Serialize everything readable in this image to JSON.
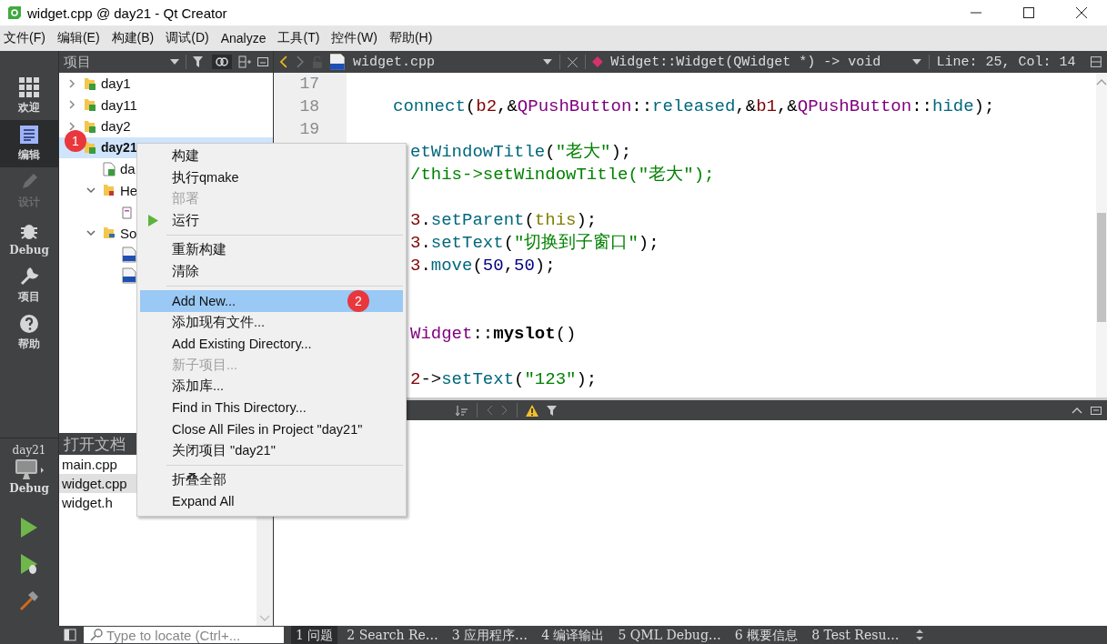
{
  "window": {
    "title": "widget.cpp @ day21 - Qt Creator"
  },
  "menu_bar": [
    "文件(F)",
    "编辑(E)",
    "构建(B)",
    "调试(D)",
    "Analyze",
    "工具(T)",
    "控件(W)",
    "帮助(H)"
  ],
  "mode_bar": {
    "modes": [
      {
        "label": "欢迎",
        "kind": "welcome",
        "selected": false,
        "disabled": false
      },
      {
        "label": "编辑",
        "kind": "edit",
        "selected": true,
        "disabled": false
      },
      {
        "label": "设计",
        "kind": "design",
        "selected": false,
        "disabled": true
      },
      {
        "label": "Debug",
        "kind": "debug",
        "selected": false,
        "disabled": false
      },
      {
        "label": "项目",
        "kind": "projects",
        "selected": false,
        "disabled": false
      },
      {
        "label": "帮助",
        "kind": "help",
        "selected": false,
        "disabled": false
      }
    ],
    "kit": {
      "project": "day21",
      "config": "Debug"
    }
  },
  "project_panel": {
    "title": "项目",
    "tree": [
      {
        "label": "day1",
        "kind": "project",
        "expanded": false,
        "selected": false
      },
      {
        "label": "day11",
        "kind": "project",
        "expanded": false,
        "selected": false
      },
      {
        "label": "day2",
        "kind": "project",
        "expanded": false,
        "selected": false
      },
      {
        "label": "day21",
        "kind": "project",
        "expanded": true,
        "selected": true,
        "badge": "1",
        "children": [
          {
            "label": "da",
            "kind": "pro-file",
            "selected": false
          },
          {
            "label": "He",
            "kind": "header-folder",
            "expanded": true,
            "selected": false,
            "children": [
              {
                "kind": "header-file",
                "selected": false
              }
            ]
          },
          {
            "label": "So",
            "kind": "source-folder",
            "expanded": true,
            "selected": false,
            "children": [
              {
                "kind": "cpp-file",
                "selected": false
              },
              {
                "kind": "cpp-file",
                "selected": false
              }
            ]
          }
        ]
      }
    ]
  },
  "open_documents": {
    "title": "打开文档",
    "items": [
      {
        "label": "main.cpp",
        "selected": false
      },
      {
        "label": "widget.cpp",
        "selected": true
      },
      {
        "label": "widget.h",
        "selected": false
      }
    ]
  },
  "editor": {
    "file": "widget.cpp",
    "symbol": "Widget::Widget(QWidget *) -> void",
    "position": "Line: 25, Col: 14",
    "line_numbers": [
      "17",
      "18",
      "19"
    ],
    "lines": [
      {
        "kind": "full"
      },
      {
        "kind": "full",
        "tokens": [
          {
            "kind": "func",
            "text": "connect"
          },
          {
            "kind": "punct",
            "text": "("
          },
          {
            "kind": "var",
            "text": "b2"
          },
          {
            "kind": "punct",
            "text": ",&"
          },
          {
            "kind": "type",
            "text": "QPushButton"
          },
          {
            "kind": "punct",
            "text": "::"
          },
          {
            "kind": "func",
            "text": "released"
          },
          {
            "kind": "punct",
            "text": ",&"
          },
          {
            "kind": "var",
            "text": "b1"
          },
          {
            "kind": "punct",
            "text": ",&"
          },
          {
            "kind": "type",
            "text": "QPushButton"
          },
          {
            "kind": "punct",
            "text": "::"
          },
          {
            "kind": "func",
            "text": "hide"
          },
          {
            "kind": "punct",
            "text": ");"
          }
        ]
      },
      {
        "kind": "full"
      },
      {
        "kind": "cut",
        "tokens": [
          {
            "kind": "func",
            "text": "etWindowTitle"
          },
          {
            "kind": "punct",
            "text": "("
          },
          {
            "kind": "string",
            "text": "\"老大\""
          },
          {
            "kind": "punct",
            "text": ");"
          }
        ]
      },
      {
        "kind": "cut",
        "tokens": [
          {
            "kind": "comment",
            "text": "/this->setWindowTitle(\"老大\");"
          }
        ]
      },
      {
        "kind": "cut"
      },
      {
        "kind": "cut",
        "tokens": [
          {
            "kind": "var",
            "text": "3"
          },
          {
            "kind": "punct",
            "text": "."
          },
          {
            "kind": "func",
            "text": "setParent"
          },
          {
            "kind": "punct",
            "text": "("
          },
          {
            "kind": "keyword",
            "text": "this"
          },
          {
            "kind": "punct",
            "text": ");"
          }
        ]
      },
      {
        "kind": "cut",
        "tokens": [
          {
            "kind": "var",
            "text": "3"
          },
          {
            "kind": "punct",
            "text": "."
          },
          {
            "kind": "func",
            "text": "setText"
          },
          {
            "kind": "punct",
            "text": "("
          },
          {
            "kind": "string",
            "text": "\"切换到子窗口\""
          },
          {
            "kind": "punct",
            "text": ");"
          }
        ]
      },
      {
        "kind": "cut",
        "tokens": [
          {
            "kind": "var",
            "text": "3"
          },
          {
            "kind": "punct",
            "text": "."
          },
          {
            "kind": "func",
            "text": "move"
          },
          {
            "kind": "punct",
            "text": "("
          },
          {
            "kind": "number",
            "text": "50"
          },
          {
            "kind": "punct",
            "text": ","
          },
          {
            "kind": "number",
            "text": "50"
          },
          {
            "kind": "punct",
            "text": ");"
          }
        ]
      },
      {
        "kind": "cut"
      },
      {
        "kind": "cut"
      },
      {
        "kind": "cut",
        "tokens": [
          {
            "kind": "type",
            "text": "Widget"
          },
          {
            "kind": "punct",
            "text": "::"
          },
          {
            "kind": "bold",
            "text": "myslot"
          },
          {
            "kind": "punct",
            "text": "()"
          }
        ]
      },
      {
        "kind": "cut"
      },
      {
        "kind": "cut",
        "tokens": [
          {
            "kind": "var",
            "text": "2"
          },
          {
            "kind": "punct",
            "text": "->"
          },
          {
            "kind": "func",
            "text": "setText"
          },
          {
            "kind": "punct",
            "text": "("
          },
          {
            "kind": "string",
            "text": "\"123\""
          },
          {
            "kind": "punct",
            "text": ");"
          }
        ]
      }
    ]
  },
  "context_menu": [
    {
      "kind": "item",
      "label": "构建",
      "disabled": false,
      "selected": false
    },
    {
      "kind": "item",
      "label": "执行qmake",
      "disabled": false,
      "selected": false
    },
    {
      "kind": "item",
      "label": "部署",
      "disabled": true,
      "selected": false
    },
    {
      "kind": "run",
      "label": "运行",
      "disabled": false,
      "selected": false
    },
    {
      "kind": "separator"
    },
    {
      "kind": "item",
      "label": "重新构建",
      "disabled": false,
      "selected": false
    },
    {
      "kind": "item",
      "label": "清除",
      "disabled": false,
      "selected": false
    },
    {
      "kind": "separator"
    },
    {
      "kind": "item",
      "label": "Add New...",
      "disabled": false,
      "selected": true,
      "badge": "2"
    },
    {
      "kind": "item",
      "label": "添加现有文件...",
      "disabled": false,
      "selected": false
    },
    {
      "kind": "item",
      "label": "Add Existing Directory...",
      "disabled": false,
      "selected": false
    },
    {
      "kind": "item",
      "label": "新子项目...",
      "disabled": true,
      "selected": false
    },
    {
      "kind": "item",
      "label": "添加库...",
      "disabled": false,
      "selected": false
    },
    {
      "kind": "item",
      "label": "Find in This Directory...",
      "disabled": false,
      "selected": false
    },
    {
      "kind": "item",
      "label": "Close All Files in Project \"day21\"",
      "disabled": false,
      "selected": false
    },
    {
      "kind": "item",
      "label": "关闭项目 \"day21\"",
      "disabled": false,
      "selected": false
    },
    {
      "kind": "separator"
    },
    {
      "kind": "item",
      "label": "折叠全部",
      "disabled": false,
      "selected": false
    },
    {
      "kind": "item",
      "label": "Expand All",
      "disabled": false,
      "selected": false
    }
  ],
  "locator": {
    "placeholder": "Type to locate (Ctrl+..."
  },
  "output_tabs": [
    {
      "label": "1 问题",
      "selected": true
    },
    {
      "label": "2 Search Re…",
      "selected": false
    },
    {
      "label": "3 应用程序…",
      "selected": false
    },
    {
      "label": "4 编译输出",
      "selected": false
    },
    {
      "label": "5 QML Debug…",
      "selected": false
    },
    {
      "label": "6 概要信息",
      "selected": false
    },
    {
      "label": "8 Test Resu…",
      "selected": false
    }
  ]
}
